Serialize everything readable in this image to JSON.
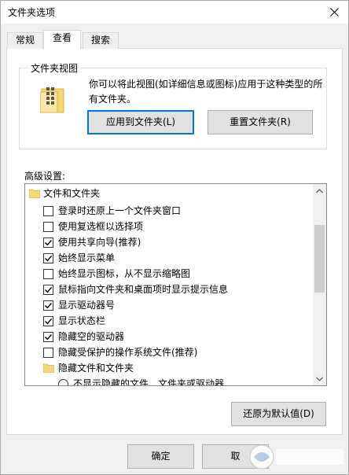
{
  "window": {
    "title": "文件夹选项"
  },
  "tabs": [
    {
      "label": "常规",
      "active": false
    },
    {
      "label": "查看",
      "active": true
    },
    {
      "label": "搜索",
      "active": false
    }
  ],
  "folder_views": {
    "legend": "文件夹视图",
    "description": "你可以将此视图(如详细信息或图标)应用于这种类型的所有文件夹。",
    "apply_label": "应用到文件夹(L)",
    "reset_label": "重置文件夹(R)"
  },
  "advanced": {
    "label": "高级设置:",
    "items": [
      {
        "type": "folder",
        "label": "文件和文件夹",
        "indent": 0
      },
      {
        "type": "checkbox",
        "label": "登录时还原上一个文件夹窗口",
        "checked": false,
        "indent": 1
      },
      {
        "type": "checkbox",
        "label": "使用复选框以选择项",
        "checked": false,
        "indent": 1
      },
      {
        "type": "checkbox",
        "label": "使用共享向导(推荐)",
        "checked": true,
        "indent": 1
      },
      {
        "type": "checkbox",
        "label": "始终显示菜单",
        "checked": true,
        "indent": 1
      },
      {
        "type": "checkbox",
        "label": "始终显示图标，从不显示缩略图",
        "checked": false,
        "indent": 1
      },
      {
        "type": "checkbox",
        "label": "鼠标指向文件夹和桌面项时显示提示信息",
        "checked": true,
        "indent": 1
      },
      {
        "type": "checkbox",
        "label": "显示驱动器号",
        "checked": true,
        "indent": 1
      },
      {
        "type": "checkbox",
        "label": "显示状态栏",
        "checked": true,
        "indent": 1
      },
      {
        "type": "checkbox",
        "label": "隐藏空的驱动器",
        "checked": true,
        "indent": 1
      },
      {
        "type": "checkbox",
        "label": "隐藏受保护的操作系统文件(推荐)",
        "checked": false,
        "indent": 1
      },
      {
        "type": "folder",
        "label": "隐藏文件和文件夹",
        "indent": 1
      },
      {
        "type": "radio",
        "label": "不显示隐藏的文件、文件夹或驱动器",
        "checked": false,
        "indent": 2
      }
    ]
  },
  "restore_defaults_label": "还原为默认值(D)",
  "footer": {
    "ok_label": "确定",
    "cancel_label": "取"
  },
  "colors": {
    "accent": "#0078d7",
    "folder": "#f7d674"
  }
}
